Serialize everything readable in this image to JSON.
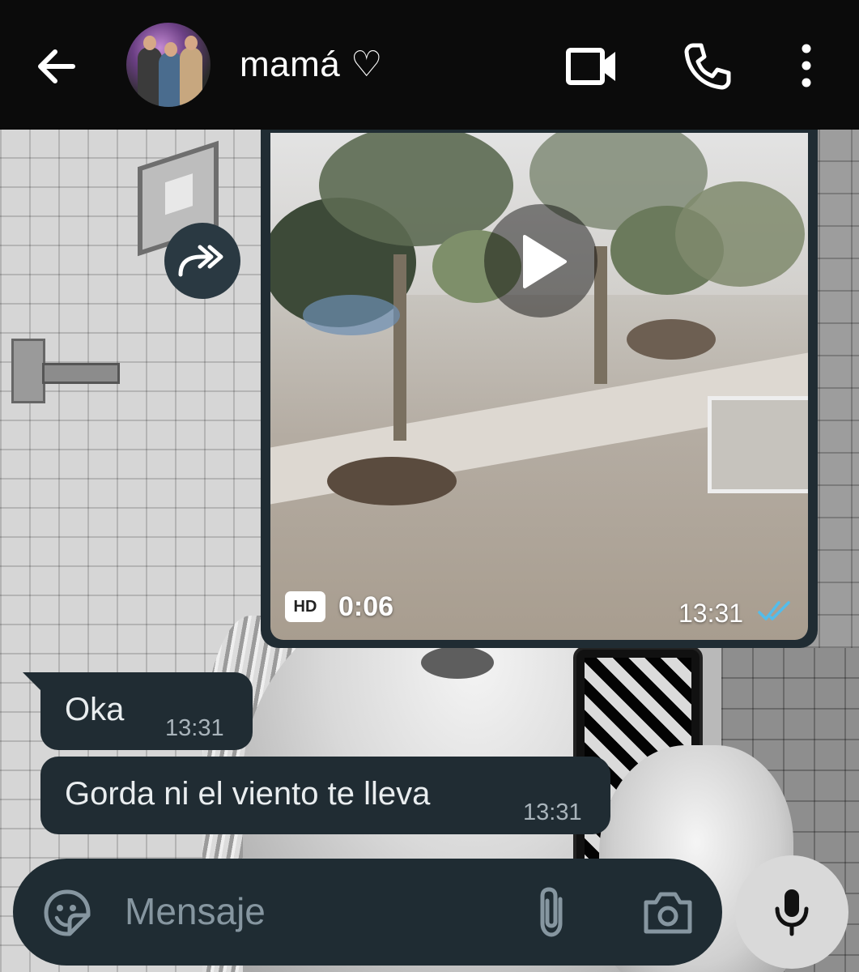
{
  "header": {
    "contact_name": "mamá ♡"
  },
  "video_message": {
    "hd_label": "HD",
    "duration": "0:06",
    "time": "13:31",
    "read_status": "read"
  },
  "messages": [
    {
      "text": "Oka",
      "time": "13:31"
    },
    {
      "text": "Gorda ni el viento te lleva",
      "time": "13:31"
    }
  ],
  "composer": {
    "placeholder": "Mensaje"
  },
  "icons": {
    "back": "arrow-left-icon",
    "video_call": "video-camera-icon",
    "voice_call": "phone-icon",
    "more": "more-vertical-icon",
    "forward": "forward-icon",
    "play": "play-icon",
    "emoji": "sticker-icon",
    "attach": "paperclip-icon",
    "camera": "camera-icon",
    "mic": "microphone-icon"
  },
  "colors": {
    "appbar_bg": "#0b0b0b",
    "bubble_bg": "#202c33",
    "read_ticks": "#53bdeb",
    "composer_bg": "#1f2c33",
    "mic_bg": "#d9d9d9"
  }
}
